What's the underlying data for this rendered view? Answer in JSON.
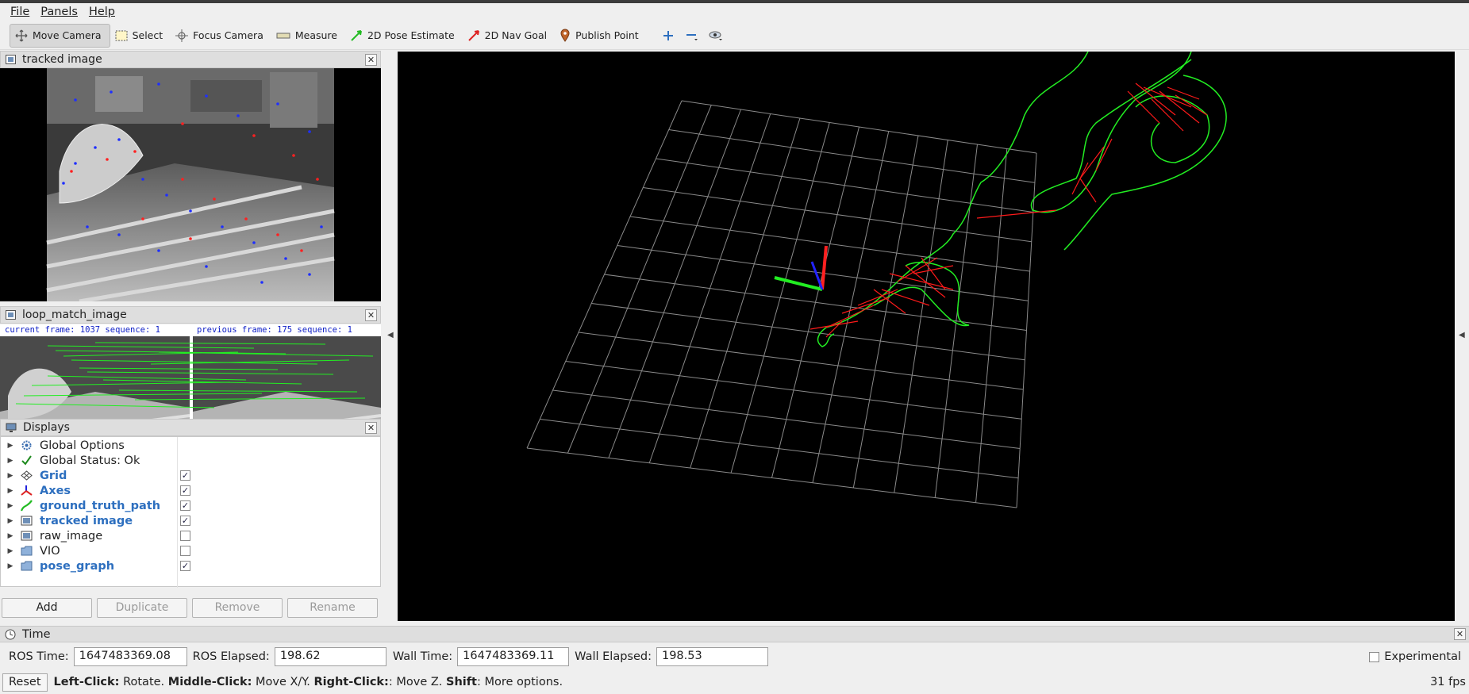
{
  "menubar": {
    "items": [
      {
        "label": "File"
      },
      {
        "label": "Panels"
      },
      {
        "label": "Help"
      }
    ]
  },
  "toolbar": {
    "move_camera": "Move Camera",
    "select": "Select",
    "focus_camera": "Focus Camera",
    "measure": "Measure",
    "pose_estimate": "2D Pose Estimate",
    "nav_goal": "2D Nav Goal",
    "publish_point": "Publish Point"
  },
  "panels": {
    "tracked_image": {
      "title": "tracked image"
    },
    "loop_match": {
      "title": "loop_match_image",
      "current_label": "current frame: 1037   sequence: 1",
      "previous_label": "previous frame: 175   sequence: 1"
    },
    "displays": {
      "title": "Displays",
      "items": [
        {
          "label": "Global Options",
          "icon": "gear-icon",
          "checked": null
        },
        {
          "label": "Global Status: Ok",
          "icon": "check-icon",
          "checked": null
        },
        {
          "label": "Grid",
          "icon": "grid-icon",
          "checked": true
        },
        {
          "label": "Axes",
          "icon": "axes-icon",
          "checked": true
        },
        {
          "label": "ground_truth_path",
          "icon": "path-icon",
          "checked": true
        },
        {
          "label": "tracked image",
          "icon": "image-icon",
          "checked": true
        },
        {
          "label": "raw_image",
          "icon": "image-icon",
          "checked": false
        },
        {
          "label": "VIO",
          "icon": "folder-icon",
          "checked": false
        },
        {
          "label": "pose_graph",
          "icon": "folder-icon",
          "checked": true
        }
      ],
      "buttons": {
        "add": "Add",
        "duplicate": "Duplicate",
        "remove": "Remove",
        "rename": "Rename"
      }
    }
  },
  "time": {
    "title": "Time",
    "ros_time_label": "ROS Time:",
    "ros_time": "1647483369.08",
    "ros_elapsed_label": "ROS Elapsed:",
    "ros_elapsed": "198.62",
    "wall_time_label": "Wall Time:",
    "wall_time": "1647483369.11",
    "wall_elapsed_label": "Wall Elapsed:",
    "wall_elapsed": "198.53",
    "experimental": "Experimental"
  },
  "status": {
    "reset": "Reset",
    "left_click": "Left-Click:",
    "left_click_desc": " Rotate. ",
    "middle_click": "Middle-Click:",
    "middle_click_desc": " Move X/Y. ",
    "right_click": "Right-Click:",
    "right_click_desc": ": Move Z. ",
    "shift": "Shift",
    "shift_desc": ": More options.",
    "fps": "31 fps"
  },
  "colors": {
    "path_green": "#22ee22",
    "loop_red": "#ff1a1a",
    "grid_line": "#8a8a8a",
    "link_blue": "#2d6fbf"
  }
}
